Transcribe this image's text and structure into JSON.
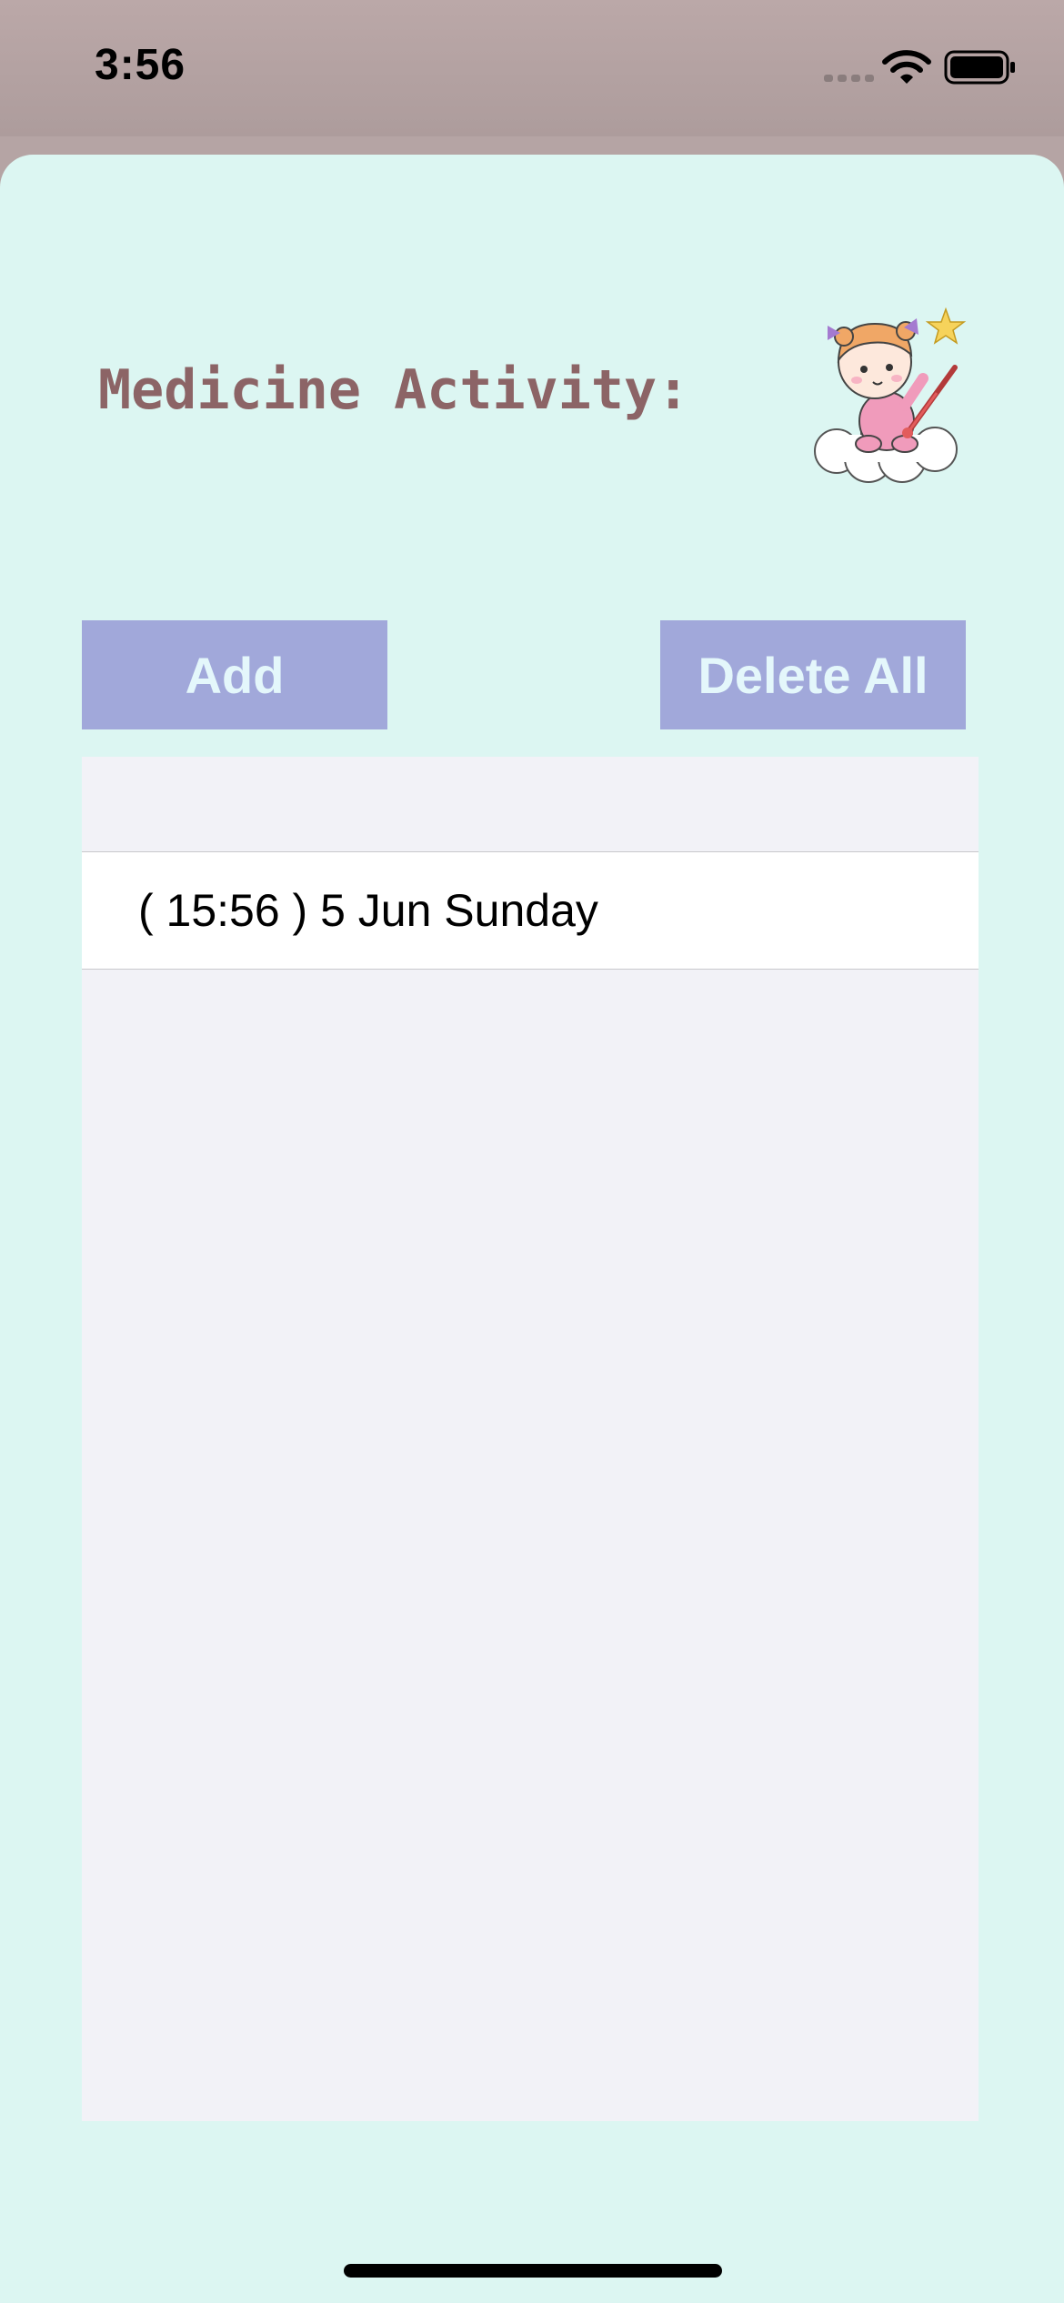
{
  "status_bar": {
    "time": "3:56",
    "icons": [
      "cellular-signal-icon",
      "wifi-icon",
      "battery-icon"
    ]
  },
  "screen": {
    "title": "Medicine Activity:",
    "mascot_icon": "baby-with-thermometer-icon"
  },
  "toolbar": {
    "add_label": "Add",
    "delete_all_label": "Delete All"
  },
  "activity_list": {
    "items": [
      {
        "label": "( 15:56 ) 5 Jun Sunday"
      }
    ]
  },
  "colors": {
    "status_bar_bg": "#b5a4a4",
    "sheet_bg": "#dcf6f2",
    "title": "#8c6466",
    "button_bg": "#a1a8da",
    "button_text": "#e4f7fb",
    "table_bg": "#f2f2f7",
    "row_bg": "#ffffff"
  }
}
